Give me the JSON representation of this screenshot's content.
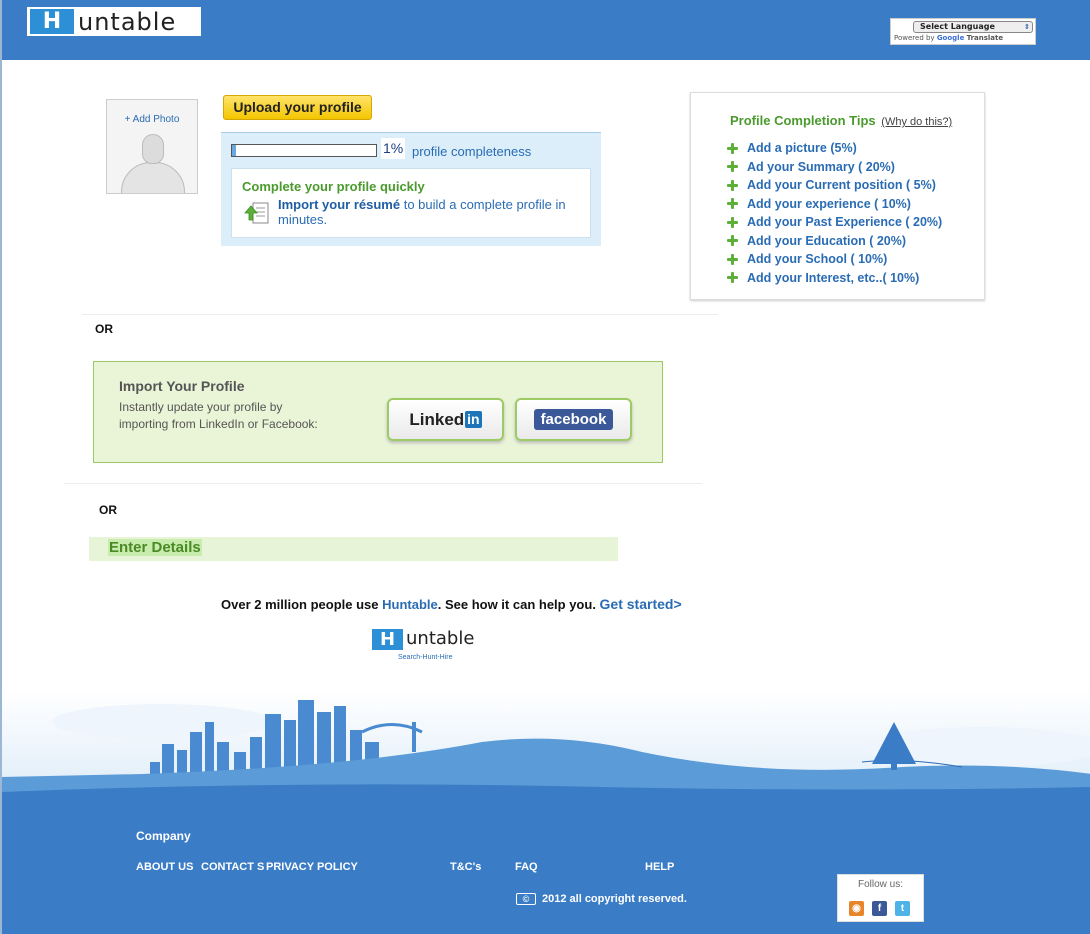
{
  "header": {
    "logo_letter": "H",
    "logo_text": "untable",
    "translate": {
      "select_label": "Select Language",
      "powered_by": "Powered by",
      "google": "Google",
      "translate_word": "Translate"
    }
  },
  "profile": {
    "add_photo": "+ Add Photo",
    "upload_button": "Upload your profile",
    "completeness_percent": "1%",
    "completeness_value": 0.01,
    "completeness_label": "profile completeness",
    "quick_title": "Complete your profile quickly",
    "import_resume_link": "Import your résumé",
    "import_resume_rest": " to build a complete profile in minutes."
  },
  "tips": {
    "title": "Profile Completion Tips",
    "why_link": "(Why do this?)",
    "items": [
      "Add a picture (5%)",
      "Ad your Summary ( 20%)",
      "Add your Current position ( 5%)",
      "Add your experience ( 10%)",
      "Add your Past Experience ( 20%)",
      "Add your Education ( 20%)",
      "Add your School ( 10%)",
      "Add your Interest, etc..( 10%)"
    ]
  },
  "or_1": "OR",
  "import_profile": {
    "title": "Import Your Profile",
    "description": "Instantly update your profile by importing from LinkedIn or Facebook:",
    "linkedin_text": "Linked",
    "linkedin_badge": "in",
    "facebook_text": "facebook"
  },
  "or_2": "OR",
  "enter_details": "Enter Details",
  "promo": {
    "text_before": "Over 2 million people use ",
    "brand": "Huntable",
    "text_after": ". See how it can help you. ",
    "get_started": "Get started>"
  },
  "footer_logo": {
    "letter": "H",
    "text": "untable",
    "tagline": "Search-Hunt-Hire"
  },
  "footer": {
    "company": "Company",
    "links": [
      "ABOUT US",
      "CONTACT S",
      "PRIVACY POLICY",
      "T&C's",
      "FAQ",
      "HELP"
    ],
    "copyright": "2012 all copyright reserved.",
    "copyright_icon": "©",
    "follow_us": "Follow us:",
    "social_icons": [
      "rss-icon",
      "facebook-icon",
      "twitter-icon"
    ]
  },
  "colors": {
    "brand_blue": "#3a7cc5",
    "link_blue": "#2a6cb4",
    "green_title": "#4a9a2d"
  }
}
